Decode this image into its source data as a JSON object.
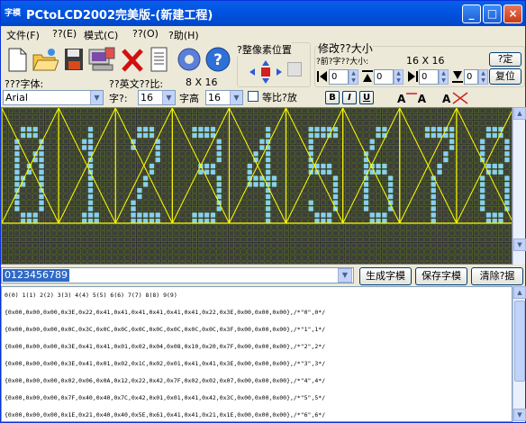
{
  "window": {
    "title": "PCtoLCD2002完美版-(新建工程)",
    "app_icon_text": "字模"
  },
  "menu": [
    "文件(F)",
    "??(E)",
    "模式(C)",
    "??(O)",
    "?助(H)"
  ],
  "toolbar": {
    "icons": [
      "new-file-icon",
      "open-folder-icon",
      "save-disk-icon",
      "computer-icon",
      "delete-x-icon",
      "document-icon",
      "settings-gear-icon",
      "help-icon"
    ]
  },
  "font_panel": {
    "font_label": "???字体:",
    "font_value": "Arial",
    "ratio_label": "??英文??比:",
    "width_label": "字?:",
    "width_value": "16",
    "height_label": "字高",
    "height_value": "16",
    "size_display": "8 X 16",
    "proportional_label": "等比?放"
  },
  "position_panel": {
    "title": "?整像素位置"
  },
  "size_panel": {
    "title": "修改??大小",
    "current_label": "?前?字??大小:",
    "current_value": "16 X 16",
    "set_button": "?定",
    "reset_button": "复位",
    "spin_values": [
      "0",
      "0",
      "0",
      "0"
    ]
  },
  "format_buttons": [
    "B",
    "I",
    "U"
  ],
  "grid": {
    "bg_color": "#2a2a2a",
    "pixel_color": "#87cefa",
    "grid_color": "#6b8e23",
    "divider_color": "#ffff00",
    "characters": [
      "0",
      "1",
      "2",
      "3",
      "4",
      "5",
      "6",
      "7",
      "8"
    ]
  },
  "input": {
    "value": "0123456789"
  },
  "actions": {
    "generate": "生成字模",
    "save": "保存字模",
    "clear": "清除?据"
  },
  "output_lines": [
    "0(0) 1(1) 2(2) 3(3) 4(4) 5(5) 6(6) 7(7) 8(8) 9(9)",
    "{0x00,0x00,0x00,0x3E,0x22,0x41,0x41,0x41,0x41,0x41,0x41,0x22,0x3E,0x00,0x00,0x00},/*\"0\",0*/",
    "{0x00,0x00,0x00,0x0C,0x3C,0x0C,0x0C,0x0C,0x0C,0x0C,0x0C,0x0C,0x3F,0x00,0x00,0x00},/*\"1\",1*/",
    "{0x00,0x00,0x00,0x3E,0x41,0x41,0x01,0x02,0x04,0x08,0x10,0x20,0x7F,0x00,0x00,0x00},/*\"2\",2*/",
    "{0x00,0x00,0x00,0x3E,0x41,0x01,0x02,0x1C,0x02,0x01,0x41,0x41,0x3E,0x00,0x00,0x00},/*\"3\",3*/",
    "{0x00,0x00,0x00,0x02,0x06,0x0A,0x12,0x22,0x42,0x7F,0x02,0x02,0x07,0x00,0x00,0x00},/*\"4\",4*/",
    "{0x00,0x00,0x00,0x7F,0x40,0x40,0x7C,0x42,0x01,0x01,0x41,0x42,0x3C,0x00,0x00,0x00},/*\"5\",5*/",
    "{0x00,0x00,0x00,0x1E,0x21,0x40,0x40,0x5E,0x61,0x41,0x41,0x21,0x1E,0x00,0x00,0x00},/*\"6\",6*/"
  ]
}
